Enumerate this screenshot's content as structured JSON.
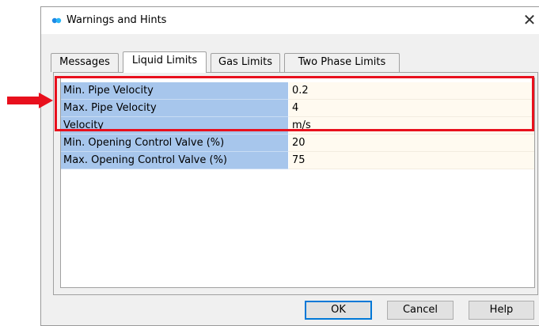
{
  "window": {
    "title": "Warnings and Hints",
    "close_glyph": "✕"
  },
  "tabs": [
    {
      "label": "Messages",
      "active": false
    },
    {
      "label": "Liquid Limits",
      "active": true
    },
    {
      "label": "Gas Limits",
      "active": false
    },
    {
      "label": "Two Phase Limits",
      "active": false
    }
  ],
  "rows": [
    {
      "name": "Min. Pipe Velocity",
      "value": "0.2"
    },
    {
      "name": "Max. Pipe Velocity",
      "value": "4"
    },
    {
      "name": "Velocity",
      "value": "m/s"
    },
    {
      "name": "Min. Opening Control Valve (%)",
      "value": "20"
    },
    {
      "name": "Max. Opening Control Valve (%)",
      "value": "75"
    }
  ],
  "buttons": {
    "ok": "OK",
    "cancel": "Cancel",
    "help": "Help"
  },
  "colors": {
    "highlight": "#e8101d",
    "name_cell": "#a7c6ec",
    "value_cell": "#fffaf0",
    "focus_border": "#0078d7"
  },
  "icons": {
    "title": "app-logo-icon",
    "close": "close-icon",
    "annotation": "red-arrow-icon"
  }
}
